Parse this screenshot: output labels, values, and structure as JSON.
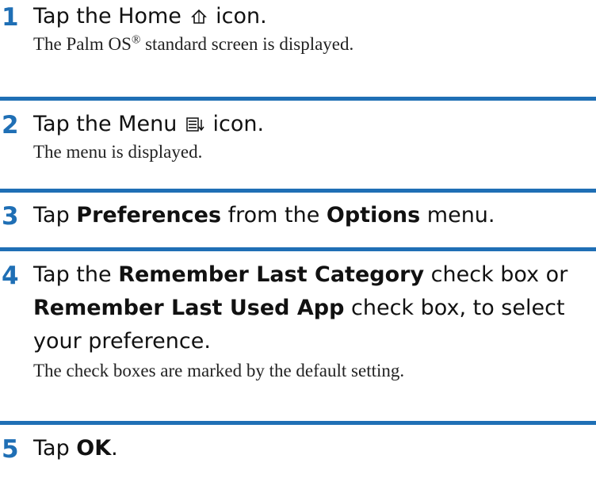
{
  "steps": [
    {
      "number": "1",
      "text_before": "Tap the Home",
      "icon": "home-icon",
      "text_after": "icon.",
      "note_before": "The Palm OS",
      "note_sup": "®",
      "note_after": " standard screen is displayed."
    },
    {
      "number": "2",
      "text_before": "Tap the Menu",
      "icon": "menu-icon",
      "text_after": "icon.",
      "note": "The menu is displayed."
    },
    {
      "number": "3",
      "t1": "Tap ",
      "b1": "Preferences",
      "t2": " from the ",
      "b2": "Options",
      "t3": " menu."
    },
    {
      "number": "4",
      "t1": "Tap the ",
      "b1": "Remember Last Category",
      "t2": " check box or ",
      "b2": "Remember Last Used App",
      "t3": " check box, to select your preference.",
      "note": "The check boxes are marked by the default setting."
    },
    {
      "number": "5",
      "t1": "Tap ",
      "b1": "OK",
      "t2": "."
    }
  ],
  "colors": {
    "accent": "#1f6fb5",
    "text": "#111111"
  }
}
